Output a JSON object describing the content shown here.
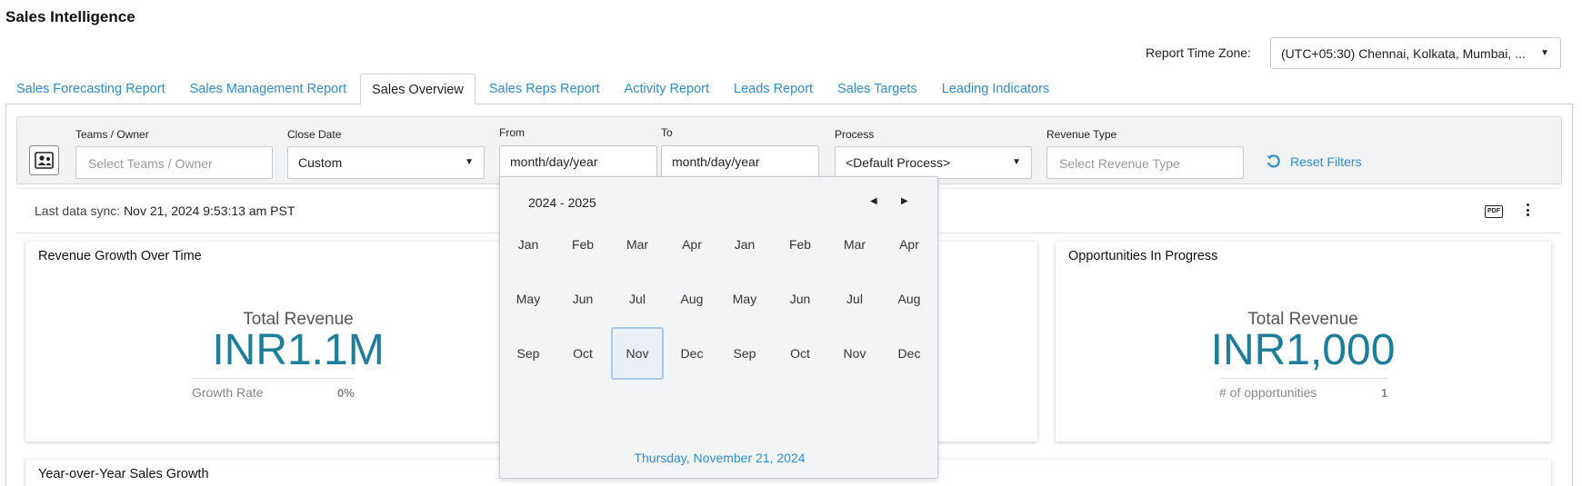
{
  "app": {
    "title": "Sales Intelligence"
  },
  "timezone": {
    "label": "Report Time Zone:",
    "value": "(UTC+05:30) Chennai, Kolkata, Mumbai, ..."
  },
  "tabs": [
    {
      "label": "Sales Forecasting Report",
      "active": false
    },
    {
      "label": "Sales Management Report",
      "active": false
    },
    {
      "label": "Sales Overview",
      "active": true
    },
    {
      "label": "Sales Reps Report",
      "active": false
    },
    {
      "label": "Activity Report",
      "active": false
    },
    {
      "label": "Leads Report",
      "active": false
    },
    {
      "label": "Sales Targets",
      "active": false
    },
    {
      "label": "Leading Indicators",
      "active": false
    }
  ],
  "filters": {
    "teams": {
      "label": "Teams / Owner",
      "placeholder": "Select Teams / Owner"
    },
    "close_date": {
      "label": "Close Date",
      "value": "Custom"
    },
    "from": {
      "label": "From",
      "value": "month/day/year"
    },
    "to": {
      "label": "To",
      "value": "month/day/year"
    },
    "process": {
      "label": "Process",
      "value": "<Default Process>"
    },
    "revenue_type": {
      "label": "Revenue Type",
      "placeholder": "Select Revenue Type"
    },
    "reset_label": "Reset Filters"
  },
  "sync": {
    "label": "Last data sync:",
    "value": "Nov 21, 2024 9:53:13 am PST"
  },
  "toolbar": {
    "pdf_icon_text": "PDF"
  },
  "cards": {
    "revenue_growth": {
      "title": "Revenue Growth Over Time",
      "metric_label": "Total Revenue",
      "metric_value": "INR1.1M",
      "sub_label": "Growth Rate",
      "sub_value": "0%"
    },
    "opportunities": {
      "title": "Opportunities In Progress",
      "metric_label": "Total Revenue",
      "metric_value": "INR1,000",
      "sub_label": "# of opportunities",
      "sub_value": "1"
    },
    "yoy": {
      "title": "Year-over-Year Sales Growth"
    }
  },
  "calendar": {
    "year_range": "2024 - 2025",
    "months": [
      "Jan",
      "Feb",
      "Mar",
      "Apr",
      "Jan",
      "Feb",
      "Mar",
      "Apr",
      "May",
      "Jun",
      "Jul",
      "Aug",
      "May",
      "Jun",
      "Jul",
      "Aug",
      "Sep",
      "Oct",
      "Nov",
      "Dec",
      "Sep",
      "Oct",
      "Nov",
      "Dec"
    ],
    "selected_index": 18,
    "today_label": "Thursday, November 21, 2024"
  },
  "colors": {
    "link": "#2f8ccb",
    "metric": "#1e7d99",
    "filter_bg": "#f2f3f4"
  },
  "icons": [
    "user-group-icon",
    "reset-icon",
    "pdf-icon",
    "more-vertical-icon",
    "chevron-down-icon",
    "chevron-left-icon",
    "chevron-right-icon"
  ]
}
